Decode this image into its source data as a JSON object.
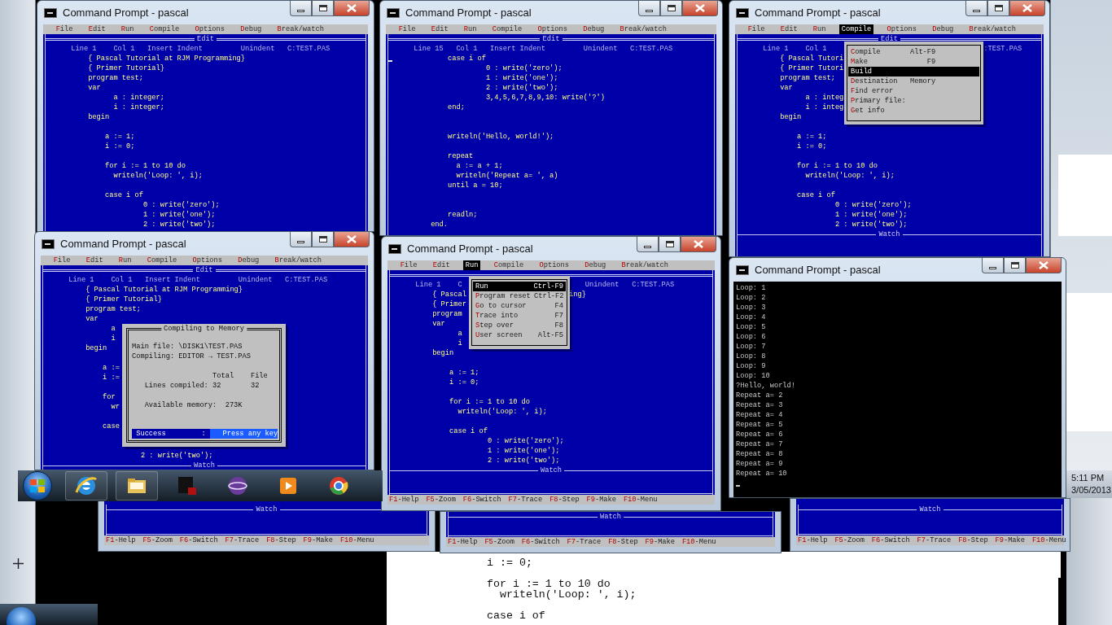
{
  "windows": [
    {
      "title": "Command Prompt - pascal",
      "menu": [
        {
          "label": "File",
          "selected": false
        },
        {
          "label": "Edit",
          "selected": false
        },
        {
          "label": "Run",
          "selected": false
        },
        {
          "label": "Compile",
          "selected": false
        },
        {
          "label": "Options",
          "selected": false
        },
        {
          "label": "Debug",
          "selected": false
        },
        {
          "label": "Break/watch",
          "selected": false
        }
      ],
      "editor": {
        "title": "Edit",
        "status": [
          {
            "kind": "line",
            "text": "Line 1"
          },
          {
            "kind": "column",
            "text": "Col 1"
          },
          {
            "kind": "insert",
            "text": "Insert"
          },
          {
            "kind": "indent",
            "text": "Indent"
          },
          {
            "kind": "unindent",
            "text": "Unindent"
          },
          {
            "kind": "file",
            "text": "C:TEST.PAS"
          }
        ],
        "lines": [
          {
            "kind": "code",
            "text": "          { Pascal Tutorial at RJM Programming}"
          },
          {
            "kind": "code",
            "text": "          { Primer Tutorial}"
          },
          {
            "kind": "code",
            "text": "          program test;"
          },
          {
            "kind": "code",
            "text": "          var"
          },
          {
            "kind": "code",
            "text": "                a : integer;"
          },
          {
            "kind": "code",
            "text": "                i : integer;"
          },
          {
            "kind": "code",
            "text": "          begin"
          },
          {
            "kind": "blank"
          },
          {
            "kind": "code",
            "text": "              a := 1;"
          },
          {
            "kind": "code",
            "text": "              i := 0;"
          },
          {
            "kind": "blank"
          },
          {
            "kind": "code",
            "text": "              for i := 1 to 10 do"
          },
          {
            "kind": "code",
            "text": "                writeln('Loop: ', i);"
          },
          {
            "kind": "blank"
          },
          {
            "kind": "code",
            "text": "              case i of"
          },
          {
            "kind": "code",
            "text": "                       0 : write('zero');"
          },
          {
            "kind": "code",
            "text": "                       1 : write('one');"
          },
          {
            "kind": "code",
            "text": "                       2 : write('two');"
          }
        ]
      }
    },
    {
      "title": "Command Prompt - pascal",
      "menu": [
        {
          "label": "File",
          "selected": false
        },
        {
          "label": "Edit",
          "selected": false
        },
        {
          "label": "Run",
          "selected": false
        },
        {
          "label": "Compile",
          "selected": false
        },
        {
          "label": "Options",
          "selected": false
        },
        {
          "label": "Debug",
          "selected": false
        },
        {
          "label": "Break/watch",
          "selected": false
        }
      ],
      "editor": {
        "title": "Edit",
        "cursor": true,
        "status": [
          {
            "kind": "line",
            "text": "Line 15"
          },
          {
            "kind": "column",
            "text": "Col 1"
          },
          {
            "kind": "insert",
            "text": "Insert"
          },
          {
            "kind": "indent",
            "text": "Indent"
          },
          {
            "kind": "unindent",
            "text": "Unindent"
          },
          {
            "kind": "file",
            "text": "C:TEST.PAS"
          }
        ],
        "lines": [
          {
            "kind": "code",
            "text": "              case i of"
          },
          {
            "kind": "code",
            "text": "                       0 : write('zero');"
          },
          {
            "kind": "code",
            "text": "                       1 : write('one');"
          },
          {
            "kind": "code",
            "text": "                       2 : write('two');"
          },
          {
            "kind": "code",
            "text": "                       3,4,5,6,7,8,9,10: write('?')"
          },
          {
            "kind": "code",
            "text": "              end;"
          },
          {
            "kind": "blank"
          },
          {
            "kind": "blank"
          },
          {
            "kind": "code",
            "text": "              writeln('Hello, world!');"
          },
          {
            "kind": "blank"
          },
          {
            "kind": "code",
            "text": "              repeat"
          },
          {
            "kind": "code",
            "text": "                a := a + 1;"
          },
          {
            "kind": "code",
            "text": "                writeln('Repeat a= ', a)"
          },
          {
            "kind": "code",
            "text": "              until a = 10;"
          },
          {
            "kind": "blank"
          },
          {
            "kind": "blank"
          },
          {
            "kind": "code",
            "text": "              readln;"
          },
          {
            "kind": "code",
            "text": "          end."
          }
        ]
      }
    },
    {
      "title": "Command Prompt - pascal",
      "menu": [
        {
          "label": "File",
          "selected": false
        },
        {
          "label": "Edit",
          "selected": false
        },
        {
          "label": "Run",
          "selected": false
        },
        {
          "label": "Compile",
          "selected": true
        },
        {
          "label": "Options",
          "selected": false
        },
        {
          "label": "Debug",
          "selected": false
        },
        {
          "label": "Break/watch",
          "selected": false
        }
      ],
      "editor": {
        "title": "Edit",
        "status": [
          {
            "kind": "line",
            "text": "Line 1"
          },
          {
            "kind": "column",
            "text": "Col 1"
          },
          {
            "kind": "file",
            "text": ":TEST.PAS"
          }
        ],
        "lines": [
          {
            "kind": "code",
            "text": "          { Pascal Tutori"
          },
          {
            "kind": "code",
            "text": "          { Primer Tutori"
          },
          {
            "kind": "code",
            "text": "          program test;"
          },
          {
            "kind": "code",
            "text": "          var"
          },
          {
            "kind": "code",
            "text": "                a : integ"
          },
          {
            "kind": "code",
            "text": "                i : integ"
          },
          {
            "kind": "code",
            "text": "          begin"
          },
          {
            "kind": "blank"
          },
          {
            "kind": "code",
            "text": "              a := 1;"
          },
          {
            "kind": "code",
            "text": "              i := 0;"
          },
          {
            "kind": "blank"
          },
          {
            "kind": "code",
            "text": "              for i := 1 to 10 do"
          },
          {
            "kind": "code",
            "text": "                writeln('Loop: ', i);"
          },
          {
            "kind": "blank"
          },
          {
            "kind": "code",
            "text": "              case i of"
          },
          {
            "kind": "code",
            "text": "                       0 : write('zero');"
          },
          {
            "kind": "code",
            "text": "                       1 : write('one');"
          },
          {
            "kind": "code",
            "text": "                       2 : write('two');"
          }
        ]
      },
      "popup": {
        "items": [
          {
            "label": "Compile",
            "shortcut": "Alt-F9",
            "selected": false
          },
          {
            "label": "Make",
            "shortcut": "F9",
            "selected": false
          },
          {
            "label": "Build",
            "selected": true
          },
          {
            "label": "Destination",
            "shortcut": "Memory",
            "selected": false
          },
          {
            "label": "Find error",
            "selected": false
          },
          {
            "label": "Primary file:",
            "selected": false
          },
          {
            "label": "Get info",
            "selected": false
          }
        ]
      },
      "watch": {
        "title": "Watch"
      }
    },
    {
      "title": "Command Prompt - pascal",
      "menu": [
        {
          "label": "File",
          "selected": false
        },
        {
          "label": "Edit",
          "selected": false
        },
        {
          "label": "Run",
          "selected": false
        },
        {
          "label": "Compile",
          "selected": false
        },
        {
          "label": "Options",
          "selected": false
        },
        {
          "label": "Debug",
          "selected": false
        },
        {
          "label": "Break/watch",
          "selected": false
        }
      ],
      "editor": {
        "title": "Edit",
        "status": [
          {
            "kind": "line",
            "text": "Line 1"
          },
          {
            "kind": "column",
            "text": "Col 1"
          },
          {
            "kind": "insert",
            "text": "Insert"
          },
          {
            "kind": "indent",
            "text": "Indent"
          },
          {
            "kind": "unindent",
            "text": "Unindent"
          },
          {
            "kind": "file",
            "text": "C:TEST.PAS"
          }
        ],
        "lines": [
          {
            "kind": "code",
            "text": "          { Pascal Tutorial at RJM Programming}"
          },
          {
            "kind": "code",
            "text": "          { Primer Tutorial}"
          },
          {
            "kind": "code",
            "text": "          program test;"
          },
          {
            "kind": "code",
            "text": "          var"
          },
          {
            "kind": "code",
            "text": "                a"
          },
          {
            "kind": "code",
            "text": "                i"
          },
          {
            "kind": "code",
            "text": "          begin"
          },
          {
            "kind": "blank"
          },
          {
            "kind": "code",
            "text": "              a :="
          },
          {
            "kind": "code",
            "text": "              i :="
          },
          {
            "kind": "blank"
          },
          {
            "kind": "code",
            "text": "              for"
          },
          {
            "kind": "code",
            "text": "                wr"
          },
          {
            "kind": "blank"
          },
          {
            "kind": "code",
            "text": "              case"
          },
          {
            "kind": "blank"
          },
          {
            "kind": "blank"
          },
          {
            "kind": "code",
            "text": "                       2 : write('two');"
          }
        ]
      },
      "dialog": {
        "title": "Compiling to Memory",
        "main_file": "Main file: \\DISK1\\TEST.PAS",
        "compiling": "Compiling: EDITOR → TEST.PAS",
        "columns": [
          "Total",
          "File"
        ],
        "rows": [
          {
            "label": "Lines compiled:",
            "total": "32",
            "file": "32"
          }
        ],
        "memory": {
          "label": "Available memory:",
          "value": "273K"
        },
        "status": "Success",
        "separator": ":",
        "prompt": "Press any key"
      },
      "watch": {
        "title": "Watch"
      }
    },
    {
      "title": "Command Prompt - pascal",
      "menu": [
        {
          "label": "File",
          "selected": false
        },
        {
          "label": "Edit",
          "selected": false
        },
        {
          "label": "Run",
          "selected": true
        },
        {
          "label": "Compile",
          "selected": false
        },
        {
          "label": "Options",
          "selected": false
        },
        {
          "label": "Debug",
          "selected": false
        },
        {
          "label": "Break/watch",
          "selected": false
        }
      ],
      "editor": {
        "status": [
          {
            "kind": "line",
            "text": "Line 1"
          },
          {
            "kind": "column",
            "text": "C"
          },
          {
            "kind": "unindent",
            "text": "Unindent"
          },
          {
            "kind": "file",
            "text": "C:TEST.PAS"
          }
        ],
        "lines": [
          {
            "kind": "code",
            "text": "          { Pascal",
            "after": "ing}"
          },
          {
            "kind": "code",
            "text": "          { Primer"
          },
          {
            "kind": "code",
            "text": "          program"
          },
          {
            "kind": "code",
            "text": "          var"
          },
          {
            "kind": "code",
            "text": "                a"
          },
          {
            "kind": "code",
            "text": "                i"
          },
          {
            "kind": "code",
            "text": "          begin"
          },
          {
            "kind": "blank"
          },
          {
            "kind": "code",
            "text": "              a := 1;"
          },
          {
            "kind": "code",
            "text": "              i := 0;"
          },
          {
            "kind": "blank"
          },
          {
            "kind": "code",
            "text": "              for i := 1 to 10 do"
          },
          {
            "kind": "code",
            "text": "                writeln('Loop: ', i);"
          },
          {
            "kind": "blank"
          },
          {
            "kind": "code",
            "text": "              case i of"
          },
          {
            "kind": "code",
            "text": "                       0 : write('zero');"
          },
          {
            "kind": "code",
            "text": "                       1 : write('one');"
          },
          {
            "kind": "code",
            "text": "                       2 : write('two');"
          }
        ]
      },
      "popup": {
        "items": [
          {
            "label": "Run",
            "shortcut": "Ctrl-F9",
            "selected": true
          },
          {
            "label": "Program reset",
            "shortcut": "Ctrl-F2",
            "selected": false
          },
          {
            "label": "Go to cursor",
            "shortcut": "F4",
            "selected": false
          },
          {
            "label": "Trace into",
            "shortcut": "F7",
            "selected": false
          },
          {
            "label": "Step over",
            "shortcut": "F8",
            "selected": false
          },
          {
            "label": "User screen",
            "shortcut": "Alt-F5",
            "selected": false
          }
        ]
      },
      "watch": {
        "title": "Watch"
      },
      "function_keys": [
        {
          "key": "F1",
          "label": "-Help"
        },
        {
          "key": "F5",
          "label": "-Zoom"
        },
        {
          "key": "F6",
          "label": "-Switch"
        },
        {
          "key": "F7",
          "label": "-Trace"
        },
        {
          "key": "F8",
          "label": "-Step"
        },
        {
          "key": "F9",
          "label": "-Make"
        },
        {
          "key": "F10",
          "label": "-Menu"
        }
      ]
    }
  ],
  "background_windows": [
    {
      "watch": {
        "title": "Watch"
      },
      "function_keys": [
        {
          "key": "F1",
          "label": "-Help"
        },
        {
          "key": "F5",
          "label": "-Zoom"
        },
        {
          "key": "F6",
          "label": "-Switch"
        },
        {
          "key": "F7",
          "label": "-Trace"
        },
        {
          "key": "F8",
          "label": "-Step"
        },
        {
          "key": "F9",
          "label": "-Make"
        },
        {
          "key": "F10",
          "label": "-Menu"
        }
      ]
    },
    {
      "watch": {
        "title": "Watch"
      },
      "function_keys": [
        {
          "key": "F1",
          "label": "-Help"
        },
        {
          "key": "F5",
          "label": "-Zoom"
        },
        {
          "key": "F6",
          "label": "-Switch"
        },
        {
          "key": "F7",
          "label": "-Trace"
        },
        {
          "key": "F8",
          "label": "-Step"
        },
        {
          "key": "F9",
          "label": "-Make"
        },
        {
          "key": "F10",
          "label": "-Menu"
        }
      ]
    },
    {
      "watch": {
        "title": "Watch"
      },
      "function_keys": [
        {
          "key": "F1",
          "label": "-Help"
        },
        {
          "key": "F5",
          "label": "-Zoom"
        },
        {
          "key": "F6",
          "label": "-Switch"
        },
        {
          "key": "F7",
          "label": "-Trace"
        },
        {
          "key": "F8",
          "label": "-Step"
        },
        {
          "key": "F9",
          "label": "-Make"
        },
        {
          "key": "F10",
          "label": "-Menu"
        }
      ]
    }
  ],
  "console": {
    "title": "Command Prompt - pascal",
    "cursor": true,
    "output": [
      "Loop: 1",
      "Loop: 2",
      "Loop: 3",
      "Loop: 4",
      "Loop: 5",
      "Loop: 6",
      "Loop: 7",
      "Loop: 8",
      "Loop: 9",
      "Loop: 10",
      "?Hello, world!",
      "Repeat a= 2",
      "Repeat a= 3",
      "Repeat a= 4",
      "Repeat a= 5",
      "Repeat a= 6",
      "Repeat a= 7",
      "Repeat a= 8",
      "Repeat a= 9",
      "Repeat a= 10"
    ]
  },
  "document": {
    "lines": [
      {
        "kind": "code",
        "text": "i := 0;"
      },
      {
        "kind": "blank"
      },
      {
        "kind": "code",
        "text": "for i := 1 to 10 do"
      },
      {
        "kind": "code",
        "text": "  writeln('Loop: ', i);"
      },
      {
        "kind": "blank"
      },
      {
        "kind": "code",
        "text": "case i of"
      }
    ]
  },
  "clock": {
    "time": "5:11 PM",
    "date": "3/05/2013"
  }
}
